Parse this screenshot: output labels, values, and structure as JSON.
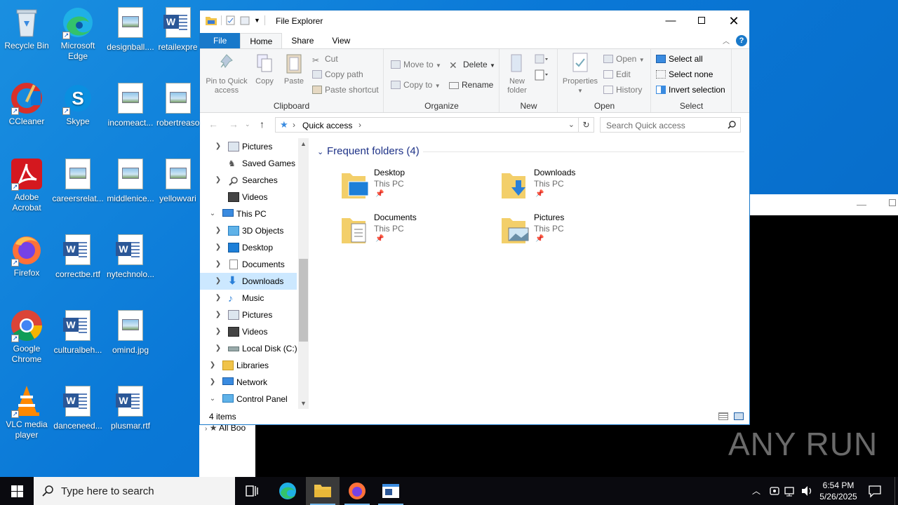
{
  "desktop": {
    "icons": [
      {
        "label": "Recycle Bin"
      },
      {
        "label": "Microsoft Edge"
      },
      {
        "label": "designball...."
      },
      {
        "label": "retailexpre"
      },
      {
        "label": "CCleaner"
      },
      {
        "label": "Skype"
      },
      {
        "label": "incomeact..."
      },
      {
        "label": "robertreaso"
      },
      {
        "label": "Adobe Acrobat"
      },
      {
        "label": "careersrelat..."
      },
      {
        "label": "middlenice..."
      },
      {
        "label": "yellowvari"
      },
      {
        "label": "Firefox"
      },
      {
        "label": "correctbe.rtf"
      },
      {
        "label": "nytechnolo..."
      },
      {
        "label": "Google Chrome"
      },
      {
        "label": "culturalbeh..."
      },
      {
        "label": "omind.jpg"
      },
      {
        "label": "VLC media player"
      },
      {
        "label": "danceneed..."
      },
      {
        "label": "plusmar.rtf"
      }
    ],
    "background_partial_text": "All Boo",
    "watermark": "ANY RUN"
  },
  "explorer": {
    "title": "File Explorer",
    "tabs": [
      "File",
      "Home",
      "Share",
      "View"
    ],
    "ribbon": {
      "clipboard": {
        "title": "Clipboard",
        "pin": "Pin to Quick access",
        "copy": "Copy",
        "paste": "Paste",
        "cut": "Cut",
        "copy_path": "Copy path",
        "paste_shortcut": "Paste shortcut"
      },
      "organize": {
        "title": "Organize",
        "move_to": "Move to",
        "copy_to": "Copy to",
        "delete": "Delete",
        "rename": "Rename"
      },
      "new": {
        "title": "New",
        "new_folder": "New folder"
      },
      "open": {
        "title": "Open",
        "properties": "Properties",
        "open": "Open",
        "edit": "Edit",
        "history": "History"
      },
      "select": {
        "title": "Select",
        "select_all": "Select all",
        "select_none": "Select none",
        "invert": "Invert selection"
      }
    },
    "address": {
      "path": "Quick access",
      "search_placeholder": "Search Quick access"
    },
    "nav": [
      {
        "label": "Pictures"
      },
      {
        "label": "Saved Games"
      },
      {
        "label": "Searches"
      },
      {
        "label": "Videos"
      },
      {
        "label": "This PC"
      },
      {
        "label": "3D Objects"
      },
      {
        "label": "Desktop"
      },
      {
        "label": "Documents"
      },
      {
        "label": "Downloads"
      },
      {
        "label": "Music"
      },
      {
        "label": "Pictures"
      },
      {
        "label": "Videos"
      },
      {
        "label": "Local Disk (C:)"
      },
      {
        "label": "Libraries"
      },
      {
        "label": "Network"
      },
      {
        "label": "Control Panel"
      }
    ],
    "section_title": "Frequent folders (4)",
    "folders": [
      {
        "name": "Desktop",
        "location": "This PC"
      },
      {
        "name": "Downloads",
        "location": "This PC"
      },
      {
        "name": "Documents",
        "location": "This PC"
      },
      {
        "name": "Pictures",
        "location": "This PC"
      }
    ],
    "status": "4 items"
  },
  "taskbar": {
    "search_placeholder": "Type here to search",
    "time": "6:54 PM",
    "date": "5/26/2025"
  }
}
